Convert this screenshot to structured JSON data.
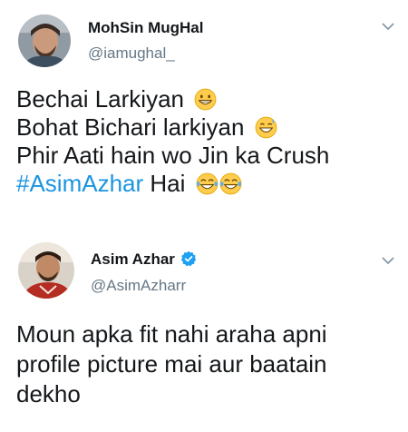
{
  "tweets": [
    {
      "display_name": "MohSin MugHal",
      "handle": "@iamughal_",
      "verified": false,
      "lines": [
        {
          "text": "Bechai Larkiyan",
          "emoji": [
            "grinning-face-emoji"
          ]
        },
        {
          "text": "Bohat Bichari larkiyan",
          "emoji": [
            "grinning-sweat-emoji"
          ]
        },
        {
          "text": "Phir Aati hain wo Jin ka Crush",
          "emoji": []
        },
        {
          "hashtag": "#AsimAzhar",
          "text": " Hai",
          "emoji": [
            "tears-of-joy-emoji",
            "tears-of-joy-emoji"
          ]
        }
      ]
    },
    {
      "display_name": "Asim Azhar",
      "handle": "@AsimAzharr",
      "verified": true,
      "lines": [
        {
          "text": "Moun apka fit nahi araha apni"
        },
        {
          "text": "profile picture mai aur baatain"
        },
        {
          "text": "dekho"
        }
      ]
    }
  ],
  "colors": {
    "text": "#14171a",
    "secondary": "#657786",
    "hashtag": "#1b95e0",
    "verified": "#1da1f2",
    "emoji_face": "#ffcc4d"
  }
}
